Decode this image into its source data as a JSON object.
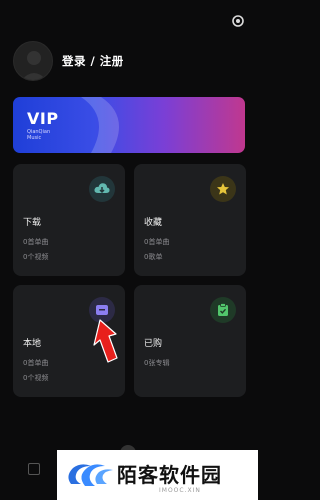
{
  "header": {
    "login_label": "登录 / 注册"
  },
  "vip": {
    "title": "VIP",
    "brand_line1": "QianQian",
    "brand_line2": "Music"
  },
  "cards": [
    {
      "title": "下载",
      "line1": "0首单曲",
      "line2": "0个视频",
      "icon": "cloud-download-icon",
      "icon_color": "#5fb3ad"
    },
    {
      "title": "收藏",
      "line1": "0首单曲",
      "line2": "0歌单",
      "icon": "star-icon",
      "icon_color": "#e4c33c"
    },
    {
      "title": "本地",
      "line1": "0首单曲",
      "line2": "0个视频",
      "icon": "local-folder-icon",
      "icon_color": "#8a7cf0"
    },
    {
      "title": "已购",
      "line1": "0张专辑",
      "line2": "",
      "icon": "purchased-check-icon",
      "icon_color": "#4fc46a"
    }
  ],
  "watermark": {
    "text": "陌客软件园",
    "sub": "IMOOC.XIN"
  },
  "colors": {
    "background": "#0b0b0c",
    "card": "#1d1e20",
    "arrow": "#e8201c"
  }
}
